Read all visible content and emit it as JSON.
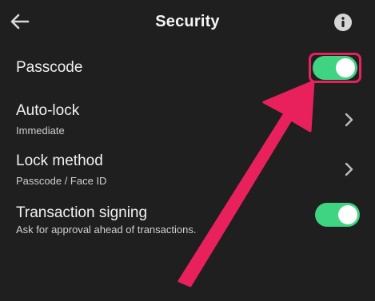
{
  "header": {
    "title": "Security"
  },
  "rows": {
    "passcode": {
      "title": "Passcode",
      "toggle_on": true
    },
    "autolock": {
      "title": "Auto-lock",
      "value": "Immediate"
    },
    "lock_method": {
      "title": "Lock method",
      "value": "Passcode / Face ID"
    },
    "transaction_signing": {
      "title": "Transaction signing",
      "description": "Ask for approval ahead of transactions.",
      "toggle_on": true
    }
  },
  "icons": {
    "back": "arrow-left-icon",
    "info": "info-icon",
    "chevron": "chevron-right-icon"
  },
  "colors": {
    "background": "#1f1f1f",
    "toggle_on": "#3fd481",
    "annotation": "#e8215d"
  }
}
